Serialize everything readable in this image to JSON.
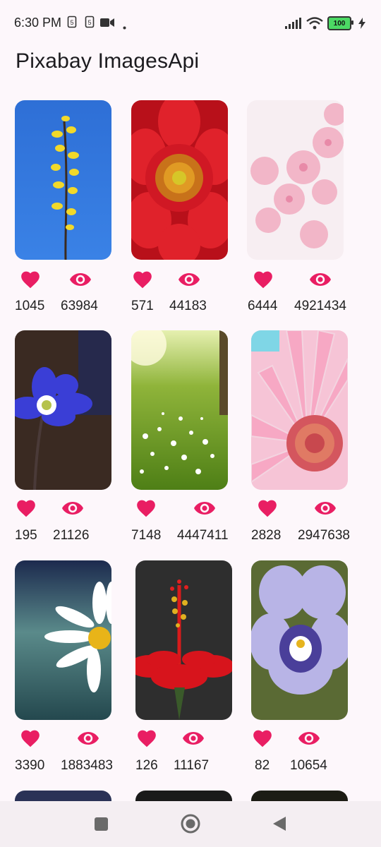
{
  "status_bar": {
    "time": "6:30 PM",
    "icons": [
      "sim-5-icon",
      "sim-5-icon",
      "video-camera-icon",
      "dot-icon"
    ],
    "battery": "100",
    "right_icons": [
      "signal-icon",
      "wifi-icon",
      "battery-icon",
      "charging-icon"
    ]
  },
  "app": {
    "title": "Pixabay ImagesApi"
  },
  "colors": {
    "accent": "#e91e63",
    "background": "#fdf7fb"
  },
  "images": [
    {
      "likes": "1045",
      "views": "63984",
      "subject": "yellow-forsythia-blue-sky"
    },
    {
      "likes": "571",
      "views": "44183",
      "subject": "red-dahlia"
    },
    {
      "likes": "6444",
      "views": "4921434",
      "subject": "pink-cherry-blossom"
    },
    {
      "likes": "195",
      "views": "21126",
      "subject": "blue-hepatica"
    },
    {
      "likes": "7148",
      "views": "4447411",
      "subject": "green-meadow-daisies"
    },
    {
      "likes": "2828",
      "views": "2947638",
      "subject": "pink-gerbera"
    },
    {
      "likes": "3390",
      "views": "1883483",
      "subject": "white-daisy"
    },
    {
      "likes": "126",
      "views": "11167",
      "subject": "red-hibiscus"
    },
    {
      "likes": "82",
      "views": "10654",
      "subject": "purple-pansy"
    }
  ],
  "navigation": {
    "buttons": [
      "recents-button",
      "home-button",
      "back-button"
    ]
  }
}
